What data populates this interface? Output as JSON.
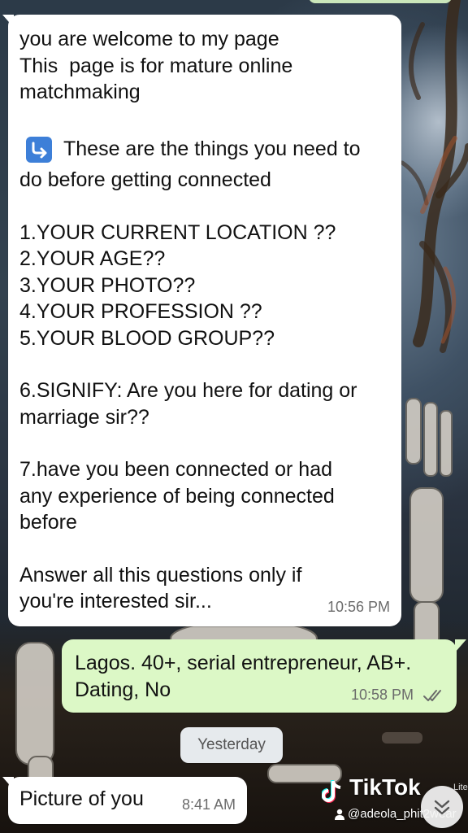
{
  "wallpaper": {
    "description_icon": "graveyard-skeleton-wallpaper"
  },
  "messages": [
    {
      "direction": "incoming",
      "text_intro": "you are welcome to my page\nThis  page is for mature online\nmatchmaking",
      "text_arrow_line": "These are the things you need to\ndo before getting connected",
      "arrow_icon": "return-arrow-emoji-icon",
      "text_questions": "1.YOUR CURRENT LOCATION ??\n2.YOUR AGE??\n3.YOUR PHOTO??\n4.YOUR PROFESSION ??\n5.YOUR BLOOD GROUP??",
      "text_q6": "6.SIGNIFY: Are you here for dating or\nmarriage sir??",
      "text_q7": "7.have you been connected or had\nany experience of being connected\nbefore",
      "text_outro": "Answer all this questions only if\nyou're interested sir...",
      "time": "10:56 PM"
    },
    {
      "direction": "outgoing",
      "text": "Lagos. 40+, serial entrepreneur, AB+.\nDating, No",
      "time": "10:58 PM",
      "status": "read"
    },
    {
      "direction": "incoming",
      "text": "Picture of you",
      "time": "8:41 AM"
    }
  ],
  "date_separator": "Yesterday",
  "watermark": {
    "logo": "TikTok",
    "variant": "Lite",
    "username": "@adeola_phit2wear"
  },
  "scroll_button": {
    "icon": "double-chevron-down-icon"
  },
  "colors": {
    "incoming_bubble": "#ffffff",
    "outgoing_bubble": "#dcf8c6",
    "read_ticks": "#6b6b6b",
    "arrow_emoji": "#3d7fd8"
  }
}
